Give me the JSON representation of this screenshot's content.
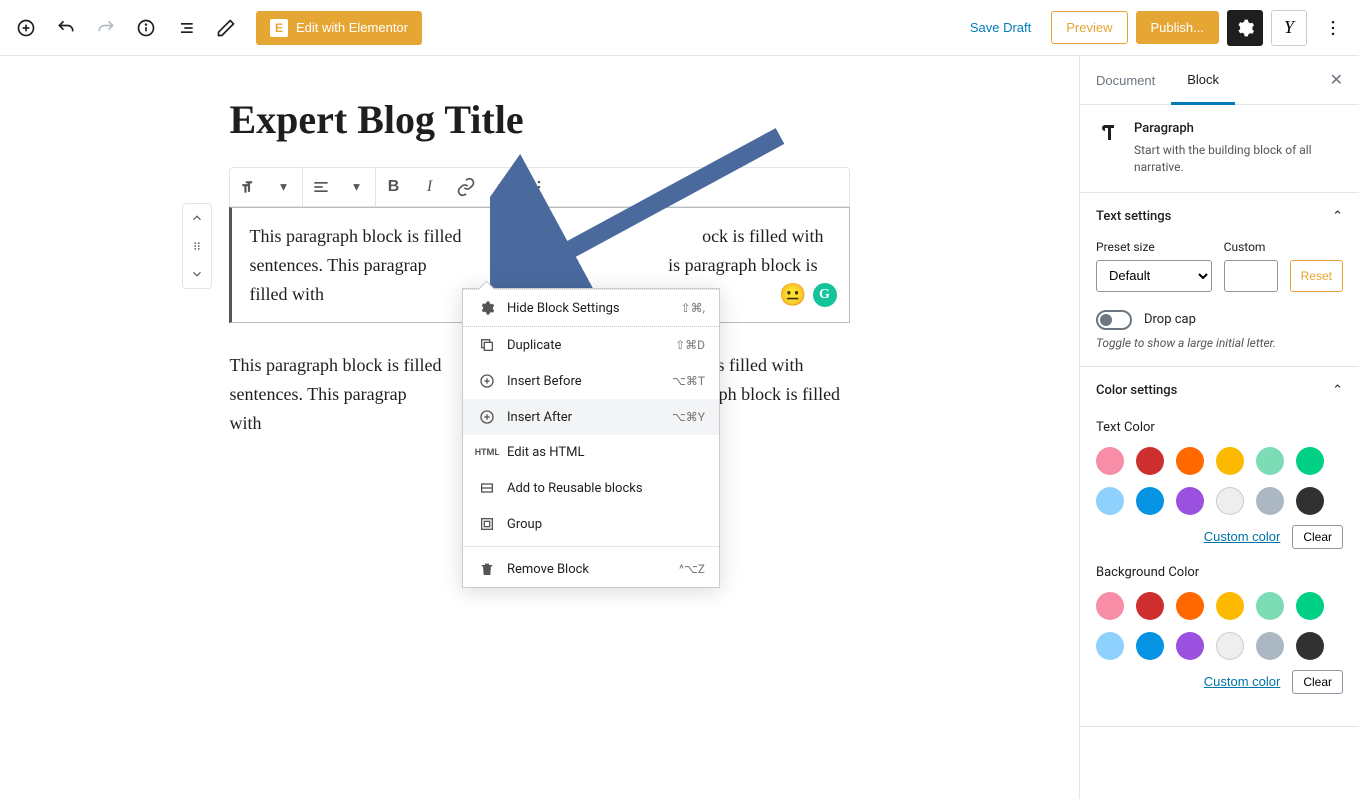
{
  "topbar": {
    "elementor_label": "Edit with Elementor",
    "save_draft": "Save Draft",
    "preview": "Preview",
    "publish": "Publish..."
  },
  "post": {
    "title": "Expert Blog Title",
    "paragraph1_visible_a": "This paragraph block is filled ",
    "paragraph1_visible_b": "ock is filled with sentences. This paragrap",
    "paragraph1_visible_c": "is paragraph block is filled with",
    "paragraph2": "This paragraph block is filled                                                    ock is filled with sentences. This paragrap                                                    is paragraph block is filled with"
  },
  "menu": {
    "hide_settings": "Hide Block Settings",
    "hide_settings_sc": "⇧⌘,",
    "duplicate": "Duplicate",
    "duplicate_sc": "⇧⌘D",
    "insert_before": "Insert Before",
    "insert_before_sc": "⌥⌘T",
    "insert_after": "Insert After",
    "insert_after_sc": "⌥⌘Y",
    "edit_html": "Edit as HTML",
    "reusable": "Add to Reusable blocks",
    "group": "Group",
    "remove": "Remove Block",
    "remove_sc": "^⌥Z"
  },
  "sidebar": {
    "tab_document": "Document",
    "tab_block": "Block",
    "block_name": "Paragraph",
    "block_desc": "Start with the building block of all narrative.",
    "text_settings": {
      "title": "Text settings",
      "preset_label": "Preset size",
      "preset_value": "Default",
      "custom_label": "Custom",
      "reset": "Reset",
      "dropcap": "Drop cap",
      "dropcap_hint": "Toggle to show a large initial letter."
    },
    "color_settings": {
      "title": "Color settings",
      "text_color": "Text Color",
      "bg_color": "Background Color",
      "custom": "Custom color",
      "clear": "Clear",
      "swatches": [
        "#f78da7",
        "#cf2e2e",
        "#ff6900",
        "#fcb900",
        "#7bdcb5",
        "#00d084",
        "#8ed1fc",
        "#0693e3",
        "#9b51e0",
        "#eeeeee",
        "#abb8c3",
        "#313131"
      ]
    }
  }
}
